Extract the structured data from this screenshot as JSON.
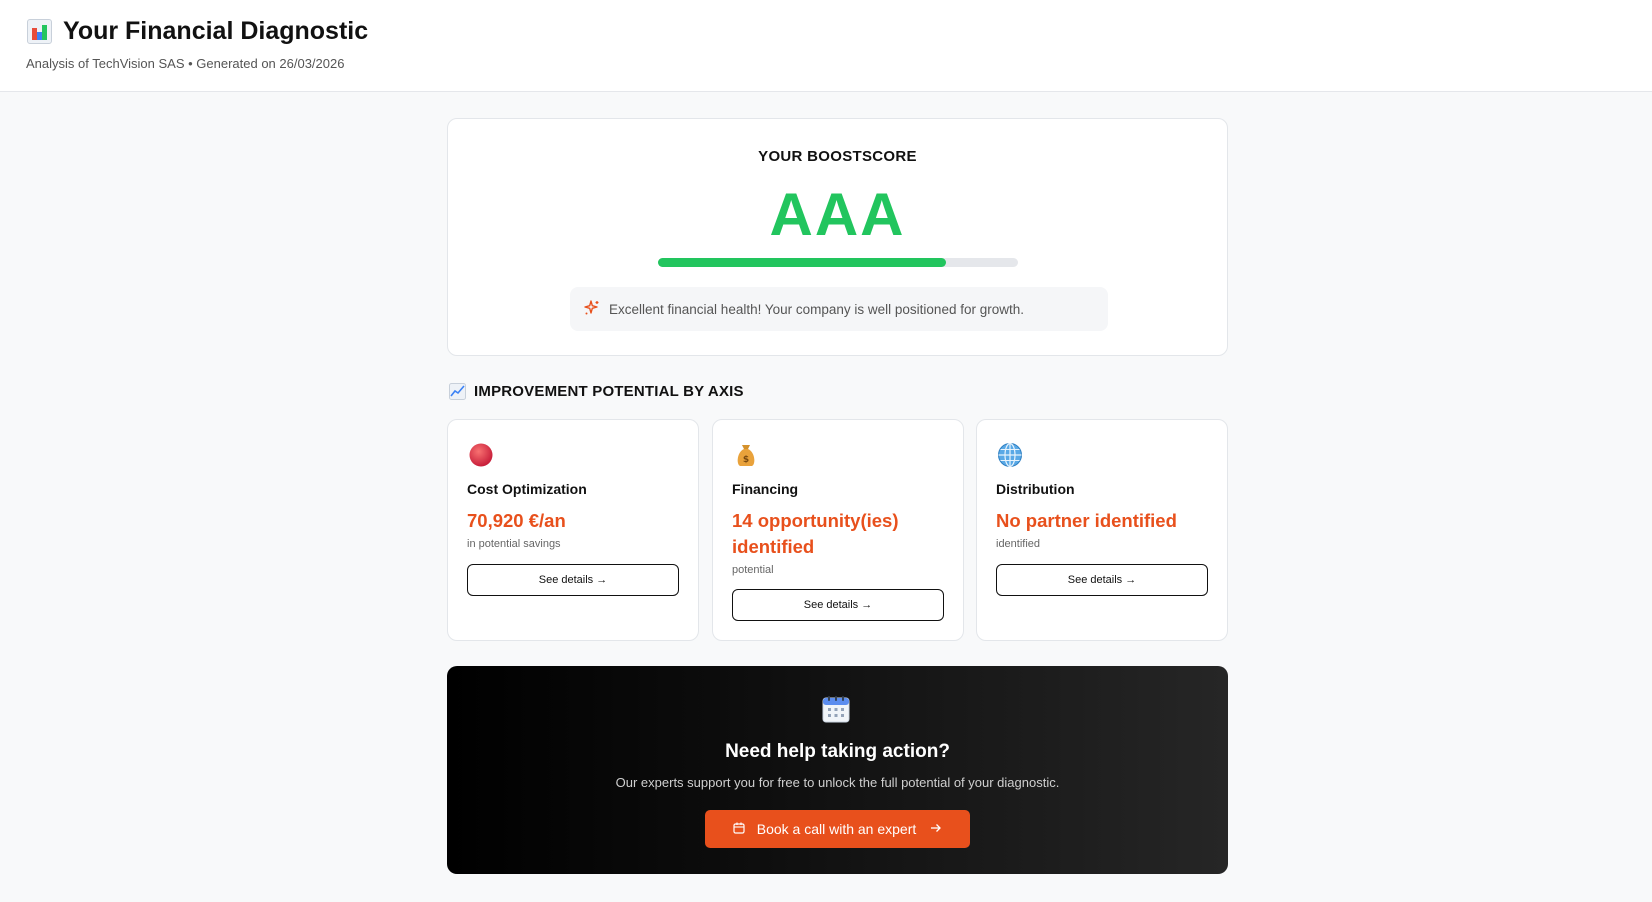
{
  "header": {
    "title": "Your Financial Diagnostic",
    "subtitle": "Analysis of TechVision SAS • Generated on 26/03/2026",
    "icon": "bar-chart-icon"
  },
  "score": {
    "label": "YOUR BOOSTSCORE",
    "value": "AAA",
    "progress_percent": 80,
    "message": "Excellent financial health! Your company is well positioned for growth.",
    "message_icon": "sparkle-icon",
    "accent_color": "#22c55e"
  },
  "section": {
    "title": "IMPROVEMENT POTENTIAL BY AXIS",
    "icon": "trend-up-icon"
  },
  "axes": [
    {
      "icon": "red-ball-icon",
      "name": "Cost Optimization",
      "value": "70,920 €/an",
      "caption": "in potential savings",
      "button": "See details →"
    },
    {
      "icon": "money-bag-icon",
      "name": "Financing",
      "value": "14 opportunity(ies) identified",
      "caption": "potential",
      "button": "See details →"
    },
    {
      "icon": "globe-icon",
      "name": "Distribution",
      "value": "No partner identified",
      "caption": "identified",
      "button": "See details →"
    }
  ],
  "cta": {
    "icon": "calendar-icon",
    "title": "Need help taking action?",
    "text": "Our experts support you for free to unlock the full potential of your diagnostic.",
    "button": "Book a call with an expert",
    "button_color": "#e8501c"
  }
}
